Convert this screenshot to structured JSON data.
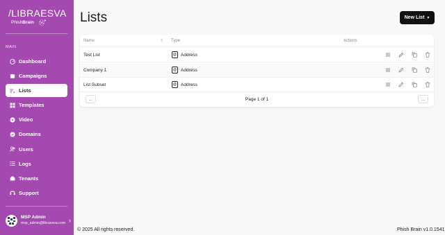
{
  "sidebar": {
    "logo_main": "/LIBRAESVA",
    "logo_sub_light": "Phish",
    "logo_sub_bold": "Brain",
    "section_label": "MAIN",
    "items": [
      {
        "label": "Dashboard",
        "icon": "gauge-icon",
        "active": false
      },
      {
        "label": "Campaigns",
        "icon": "campaign-icon",
        "active": false
      },
      {
        "label": "Lists",
        "icon": "list-icon",
        "active": true
      },
      {
        "label": "Templates",
        "icon": "template-icon",
        "active": false
      },
      {
        "label": "Video",
        "icon": "video-icon",
        "active": false
      },
      {
        "label": "Domains",
        "icon": "domain-icon",
        "active": false
      },
      {
        "label": "Users",
        "icon": "users-icon",
        "active": false
      },
      {
        "label": "Logs",
        "icon": "logs-icon",
        "active": false
      },
      {
        "label": "Tenants",
        "icon": "tenants-icon",
        "active": false
      },
      {
        "label": "Support",
        "icon": "headset-icon",
        "active": false
      }
    ],
    "user": {
      "name": "MSP Admin",
      "email": "msp_admin@libraesva.com"
    }
  },
  "main": {
    "title": "Lists",
    "new_button": "New List"
  },
  "table": {
    "columns": [
      "Name",
      "Type",
      "Actions"
    ],
    "rows": [
      {
        "name": "Test List",
        "type": "Address"
      },
      {
        "name": "Company 1",
        "type": "Address"
      },
      {
        "name": "List Subset",
        "type": "Address"
      }
    ],
    "pagination": "Page 1 of 1"
  },
  "footer": {
    "copyright": "© 2025 All rights reserved.",
    "version": "Phish Brain v1.0.1541"
  },
  "colors": {
    "sidebar": "#a449b0",
    "button": "#111111"
  }
}
